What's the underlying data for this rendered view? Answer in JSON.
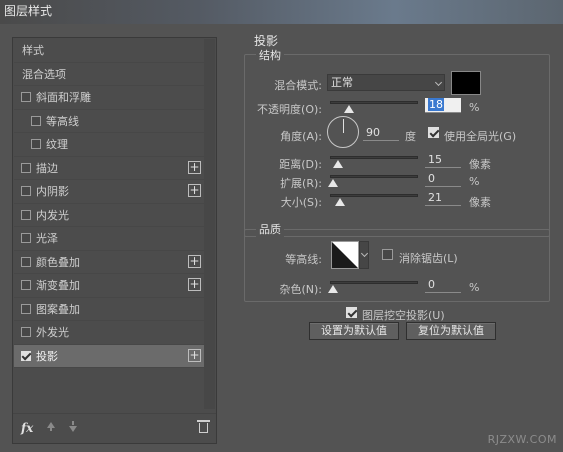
{
  "window": {
    "title": "图层样式"
  },
  "left": {
    "items": [
      {
        "label": "样式",
        "checkbox": false,
        "plus": false
      },
      {
        "label": "混合选项",
        "checkbox": false,
        "plus": false
      },
      {
        "label": "斜面和浮雕",
        "checkbox": true,
        "checked": false,
        "plus": false
      },
      {
        "label": "等高线",
        "checkbox": true,
        "checked": false,
        "plus": false,
        "indent": true
      },
      {
        "label": "纹理",
        "checkbox": true,
        "checked": false,
        "plus": false,
        "indent": true
      },
      {
        "label": "描边",
        "checkbox": true,
        "checked": false,
        "plus": true
      },
      {
        "label": "内阴影",
        "checkbox": true,
        "checked": false,
        "plus": true
      },
      {
        "label": "内发光",
        "checkbox": true,
        "checked": false,
        "plus": false
      },
      {
        "label": "光泽",
        "checkbox": true,
        "checked": false,
        "plus": false
      },
      {
        "label": "颜色叠加",
        "checkbox": true,
        "checked": false,
        "plus": true
      },
      {
        "label": "渐变叠加",
        "checkbox": true,
        "checked": false,
        "plus": true
      },
      {
        "label": "图案叠加",
        "checkbox": true,
        "checked": false,
        "plus": false
      },
      {
        "label": "外发光",
        "checkbox": true,
        "checked": false,
        "plus": false
      },
      {
        "label": "投影",
        "checkbox": true,
        "checked": true,
        "plus": true,
        "selected": true
      }
    ],
    "footer": {
      "fx": "fx"
    }
  },
  "shadow": {
    "title": "投影",
    "structure": {
      "title": "结构",
      "blend_mode_label": "混合模式:",
      "blend_mode_value": "正常",
      "color": "#000000",
      "opacity_label": "不透明度(O):",
      "opacity_value": "18",
      "opacity_unit": "%",
      "opacity_level": 0.18,
      "angle_label": "角度(A):",
      "angle_value": "90",
      "angle_unit": "度",
      "global_light_label": "使用全局光(G)",
      "global_light_checked": true,
      "distance_label": "距离(D):",
      "distance_value": "15",
      "distance_unit": "像素",
      "distance_level": 0.06,
      "spread_label": "扩展(R):",
      "spread_value": "0",
      "spread_unit": "%",
      "spread_level": 0,
      "size_label": "大小(S):",
      "size_value": "21",
      "size_unit": "像素",
      "size_level": 0.08
    },
    "quality": {
      "title": "品质",
      "contour_label": "等高线:",
      "antialias_label": "消除锯齿(L)",
      "antialias_checked": false,
      "noise_label": "杂色(N):",
      "noise_value": "0",
      "noise_unit": "%",
      "noise_level": 0
    },
    "knockout_label": "图层挖空投影(U)",
    "knockout_checked": true,
    "set_default_label": "设置为默认值",
    "reset_default_label": "复位为默认值"
  },
  "watermark": "RJZXW.COM"
}
